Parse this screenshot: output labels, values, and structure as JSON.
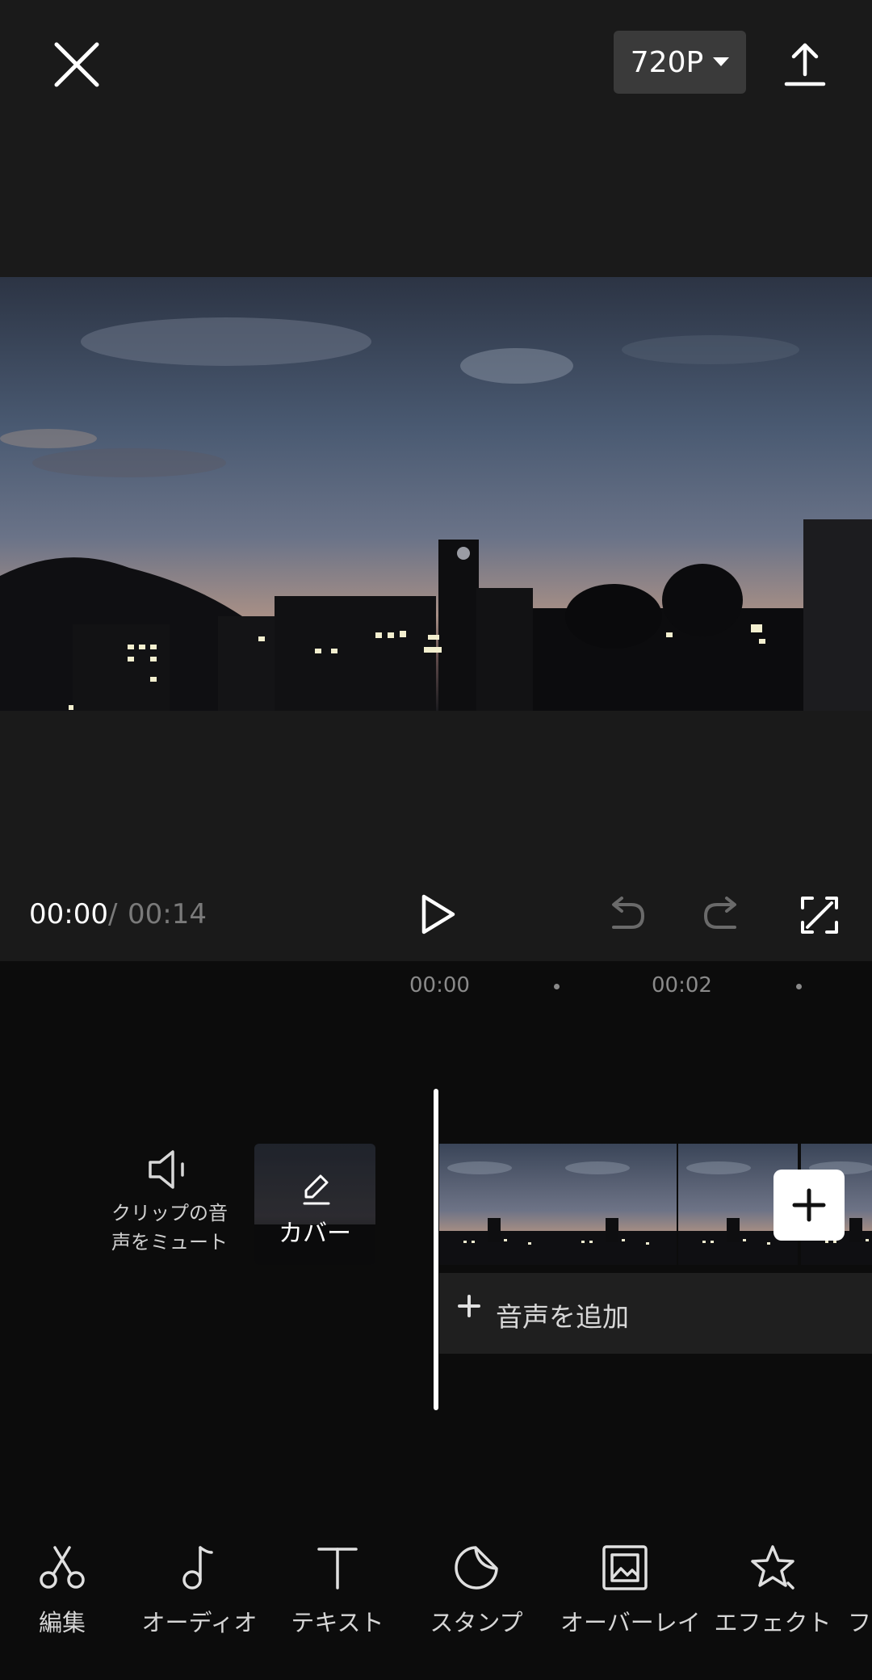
{
  "header": {
    "resolution_label": "720P"
  },
  "playback": {
    "current_time": "00:00",
    "separator": "/",
    "total_time": "00:14"
  },
  "timeline": {
    "ruler": [
      "00:00",
      "00:02"
    ],
    "mute_label_line1": "クリップの音",
    "mute_label_line2": "声をミュート",
    "cover_label": "カバー",
    "add_audio_label": "音声を追加"
  },
  "toolbar": {
    "items": [
      {
        "label": "編集",
        "icon": "scissors-icon"
      },
      {
        "label": "オーディオ",
        "icon": "music-note-icon"
      },
      {
        "label": "テキスト",
        "icon": "text-icon"
      },
      {
        "label": "スタンプ",
        "icon": "sticker-icon"
      },
      {
        "label": "オーバーレイ",
        "icon": "overlay-icon"
      },
      {
        "label": "エフェクト",
        "icon": "effect-star-icon"
      },
      {
        "label": "フ",
        "icon": "filter-icon"
      }
    ]
  },
  "colors": {
    "background": "#0c0c0c",
    "panel": "#1a1a1a",
    "accent": "#ffffff",
    "muted_text": "#7a7a7a"
  }
}
